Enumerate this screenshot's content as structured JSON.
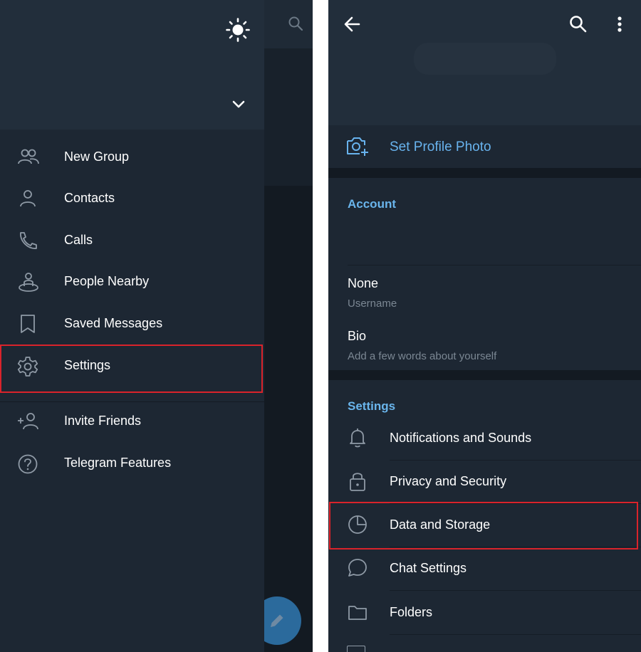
{
  "drawer": {
    "items": [
      {
        "label": "New Group",
        "icon": "users-icon"
      },
      {
        "label": "Contacts",
        "icon": "user-icon"
      },
      {
        "label": "Calls",
        "icon": "phone-icon"
      },
      {
        "label": "People Nearby",
        "icon": "people-nearby-icon"
      },
      {
        "label": "Saved Messages",
        "icon": "bookmark-icon"
      },
      {
        "label": "Settings",
        "icon": "gear-icon"
      },
      {
        "label": "Invite Friends",
        "icon": "add-user-icon"
      },
      {
        "label": "Telegram Features",
        "icon": "help-icon"
      }
    ]
  },
  "profile": {
    "set_photo": "Set Profile Photo",
    "account_title": "Account",
    "username_value": "None",
    "username_label": "Username",
    "bio_label": "Bio",
    "bio_placeholder": "Add a few words about yourself"
  },
  "settings": {
    "title": "Settings",
    "items": [
      {
        "label": "Notifications and Sounds",
        "icon": "bell-icon"
      },
      {
        "label": "Privacy and Security",
        "icon": "lock-icon"
      },
      {
        "label": "Data and Storage",
        "icon": "pie-chart-icon"
      },
      {
        "label": "Chat Settings",
        "icon": "chat-bubble-icon"
      },
      {
        "label": "Folders",
        "icon": "folder-icon"
      }
    ]
  },
  "colors": {
    "accent": "#68b3ee",
    "highlight": "#d9232b",
    "background": "#1d2733"
  }
}
